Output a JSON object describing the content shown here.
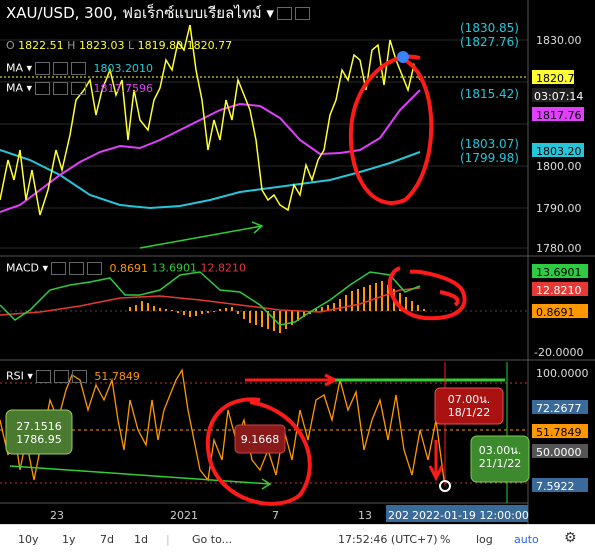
{
  "header": {
    "title": "XAU/USD, 300, ฟอเร็กซ์แบบเรียลไทม์ ▾",
    "ohlc": {
      "o_label": "O",
      "o": "1822.51",
      "h_label": "H",
      "h": "1823.03",
      "l_label": "L",
      "l": "1819.80",
      "c": "1820.77"
    }
  },
  "indicators": {
    "ma1": {
      "label": "MA ▾",
      "value": "1803.2010",
      "color": "#26c6da"
    },
    "ma2": {
      "label": "MA ▾",
      "value": "1817.7596",
      "color": "#e040fb"
    },
    "macd": {
      "label": "MACD ▾",
      "v1": "0.8691",
      "v2": "13.6901",
      "v3": "12.8210"
    },
    "rsi": {
      "label": "RSI ▾",
      "value": "51.7849"
    }
  },
  "overlay_notes": {
    "top_right_1": "(1830.85)",
    "top_right_2": "(1827.76)",
    "mid_right": "(1815.42)",
    "low_right_1": "(1803.07)",
    "low_right_2": "(1799.98)"
  },
  "price_axis": {
    "ticks": [
      "1830.00",
      "1820.00",
      "1810.00",
      "1800.00",
      "1790.00",
      "1780.00"
    ],
    "tags": {
      "current": "1820.77",
      "countdown": "03:07:14",
      "ma2": "1817.76",
      "ma1": "1803.20"
    }
  },
  "macd_axis": {
    "ticks": [
      "-20.0000"
    ],
    "tags": {
      "t1": "13.6901",
      "t2": "12.8210",
      "t3": "0.8691"
    }
  },
  "rsi_axis": {
    "ticks": [
      "100.0000",
      "50.0000"
    ],
    "tags": {
      "t1": "72.2677",
      "t2": "51.7849",
      "t3": "7.5922"
    }
  },
  "annotations": {
    "left_box_line1": "27.1516",
    "left_box_line2": "1786.95",
    "mid_box": "9.1668",
    "red_box_line1": "07.00น.",
    "red_box_line2": "18/1/22",
    "green_box_line1": "03.00น.",
    "green_box_line2": "21/1/22"
  },
  "time_axis": {
    "ticks": [
      "23",
      "2021",
      "7",
      "13",
      "202"
    ],
    "cursor_label": "2022-01-19 12:00:00"
  },
  "bottom_bar": {
    "ranges": [
      "10y",
      "1y",
      "7d",
      "1d"
    ],
    "goto": "Go to...",
    "clock": "17:52:46 (UTC+7)",
    "percent": "%",
    "log": "log",
    "auto": "auto",
    "settings_icon": "gear-icon"
  },
  "colors": {
    "price": "#ffff33",
    "ma1": "#26c6da",
    "ma2": "#e040fb",
    "macd": "#2ecc40",
    "signal": "#e53935",
    "hist": "#ff9800",
    "rsi": "#ff9800",
    "annot_red": "#ff1a1a",
    "annot_green": "#32cd32"
  }
}
